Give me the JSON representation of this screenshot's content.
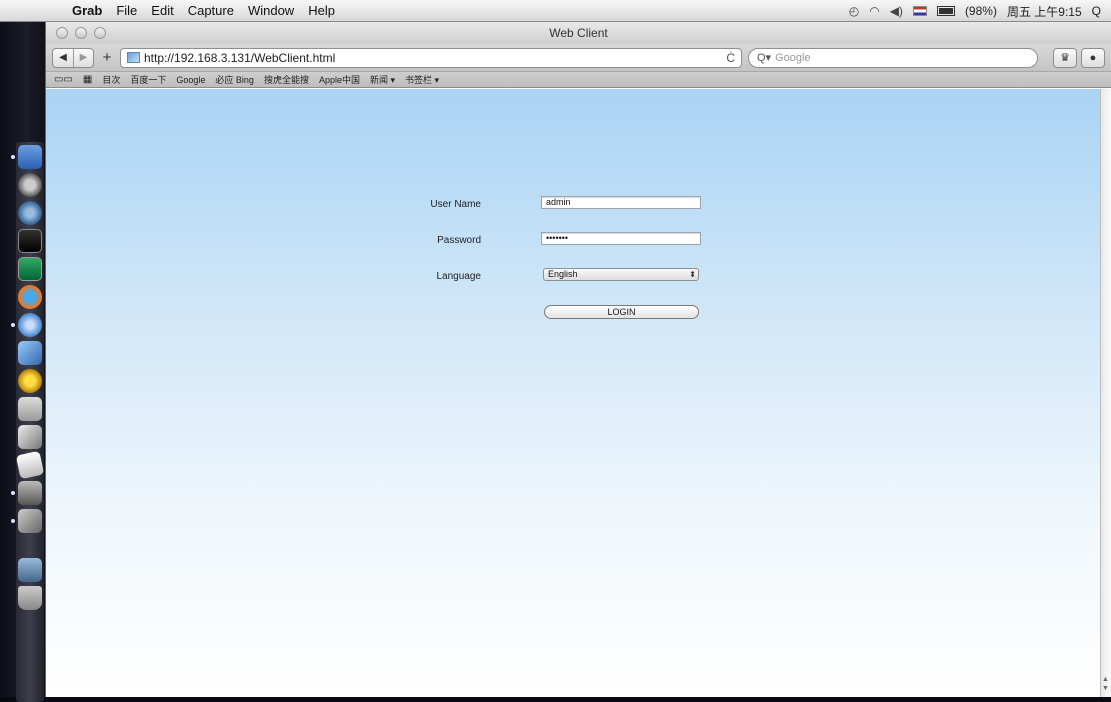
{
  "menubar": {
    "apple_glyph": "",
    "items": [
      "Grab",
      "File",
      "Edit",
      "Capture",
      "Window",
      "Help"
    ],
    "status": {
      "battery_percent": "(98%)",
      "clock": "周五 上午9:15",
      "search_glyph": "Q"
    }
  },
  "window": {
    "title": "Web Client",
    "toolbar": {
      "back": "◀",
      "forward": "▶",
      "plus": "+",
      "url": "http://192.168.3.131/WebClient.html",
      "reload": "Ċ",
      "search_placeholder": "Google",
      "search_prefix": "Q▾"
    },
    "bookmarks": [
      "目次",
      "百度一下",
      "Google",
      "必应 Bing",
      "搜虎全能搜",
      "Apple中国",
      "新闻 ▾",
      "书签栏 ▾"
    ]
  },
  "login": {
    "username_label": "User Name",
    "username_value": "admin",
    "password_label": "Password",
    "password_value": "•••••••",
    "language_label": "Language",
    "language_value": "English",
    "login_button": "LOGIN"
  },
  "colors": {
    "page_top": "#a9d3f4",
    "page_bottom": "#ffffff",
    "menubar": "#e5e5e5"
  }
}
